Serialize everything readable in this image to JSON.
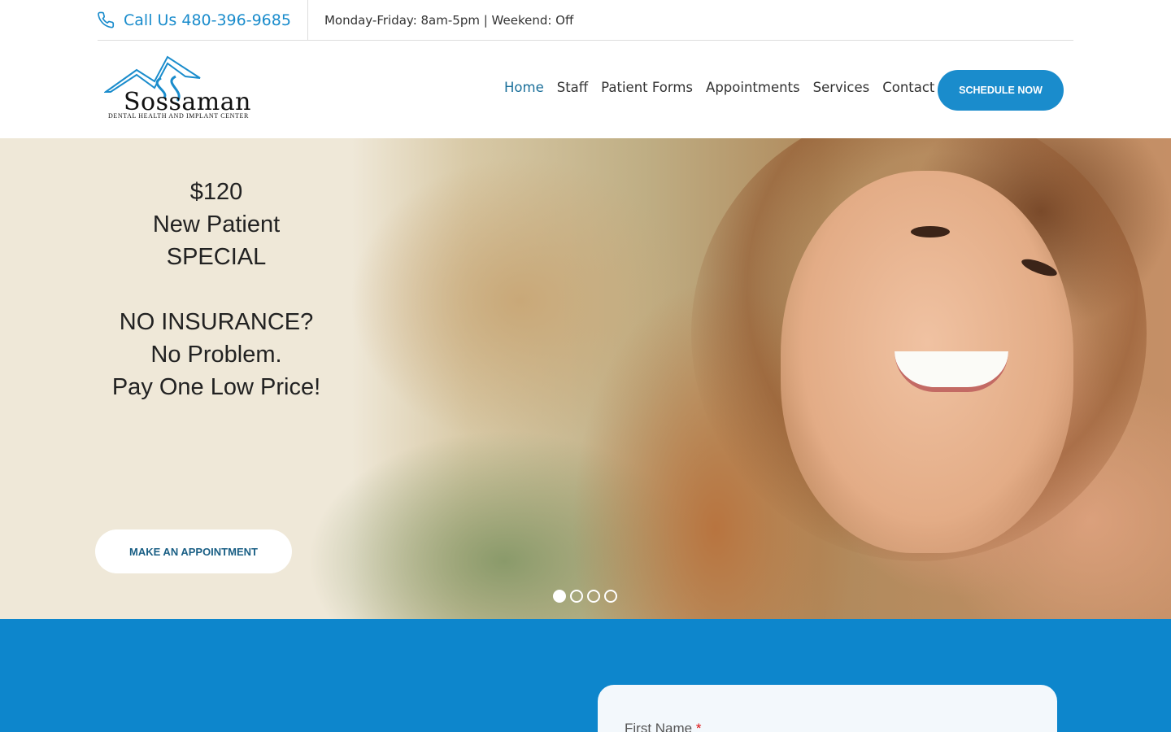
{
  "topbar": {
    "phone_label": "Call Us 480-396-9685",
    "hours": "Monday-Friday: 8am-5pm | Weekend: Off"
  },
  "logo": {
    "name": "Sossaman",
    "tagline": "DENTAL HEALTH AND IMPLANT CENTER"
  },
  "nav": {
    "items": [
      "Home",
      "Staff",
      "Patient Forms",
      "Appointments",
      "Services",
      "Contact"
    ],
    "active": "Home"
  },
  "header": {
    "schedule_label": "SCHEDULE NOW"
  },
  "hero": {
    "lines": [
      "$120",
      "New Patient",
      "SPECIAL",
      "NO INSURANCE?",
      "No Problem.",
      "Pay One Low Price!"
    ],
    "button_label": "MAKE AN APPOINTMENT",
    "slides_count": 4,
    "active_slide": 1
  },
  "form": {
    "first_name_label": "First Name",
    "required_mark": "*"
  },
  "colors": {
    "accent": "#1a8ccc",
    "section_blue": "#0d86cc",
    "nav_active": "#1a6f9a",
    "hero_panel": "#efe8d8"
  }
}
